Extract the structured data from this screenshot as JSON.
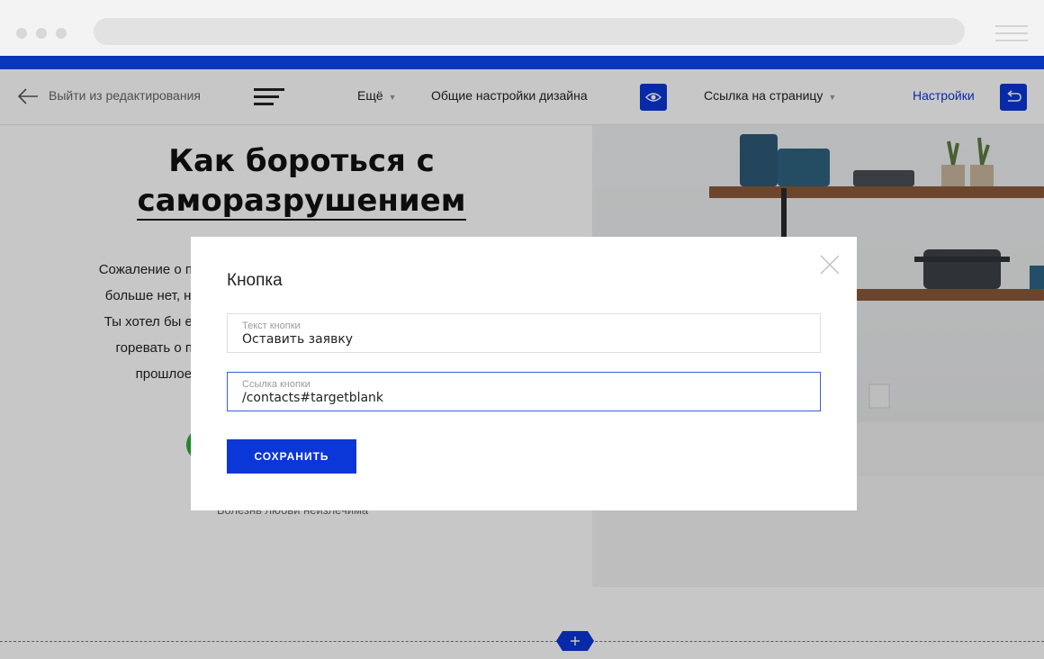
{
  "toolbar": {
    "exit_label": "Выйти из редактирования",
    "more_label": "Ещё",
    "design_settings_label": "Общие настройки дизайна",
    "page_link_label": "Ссылка на страницу",
    "settings_label": "Настройки"
  },
  "page": {
    "headline_line1": "Как бороться с",
    "headline_line2": "саморазрушением",
    "body_lines": [
      "Сожаление о прошлом",
      "больше нет, но ты по",
      "Ты хотел бы его верн",
      "горевать о прошл",
      "прошлое, в"
    ],
    "caption": "Болезнь любви неизлечима"
  },
  "modal": {
    "title": "Кнопка",
    "fields": [
      {
        "label": "Текст кнопки",
        "value": "Оставить заявку"
      },
      {
        "label": "Ссылка кнопки",
        "value": "/contacts#targetblank"
      }
    ],
    "save_label": "СОХРАНИТЬ"
  },
  "colors": {
    "accent": "#0b36d8",
    "brand_strip": "#0b36b8",
    "button_green": "#2faa3c"
  },
  "icons": {
    "back": "arrow-left-icon",
    "menu": "hamburger-icon",
    "preview": "eye-icon",
    "undo": "undo-icon",
    "close": "close-icon",
    "add": "plus-icon"
  }
}
